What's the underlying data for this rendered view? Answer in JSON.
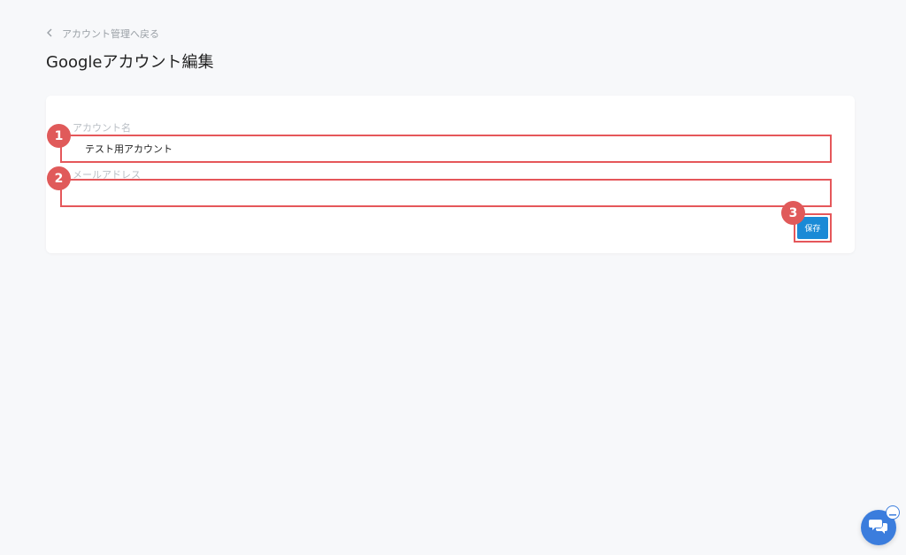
{
  "header": {
    "back_label": "アカウント管理へ戻る",
    "back_icon": "chevron-left-icon",
    "title": "Googleアカウント編集"
  },
  "form": {
    "account_name_label": "アカウント名",
    "account_name_value": "テスト用アカウント",
    "email_label": "メールアドレス",
    "email_value": ""
  },
  "actions": {
    "save_label": "保存"
  },
  "annotations": {
    "badge_1": "1",
    "badge_2": "2",
    "badge_3": "3"
  },
  "colors": {
    "background": "#f7f8fa",
    "card": "#ffffff",
    "annotation_red": "#e5575a",
    "primary_blue": "#1a8ad6",
    "chat_blue": "#3b7ddd"
  },
  "chat": {
    "icon": "chat-bubbles-icon",
    "minimize_icon": "minus-icon"
  }
}
